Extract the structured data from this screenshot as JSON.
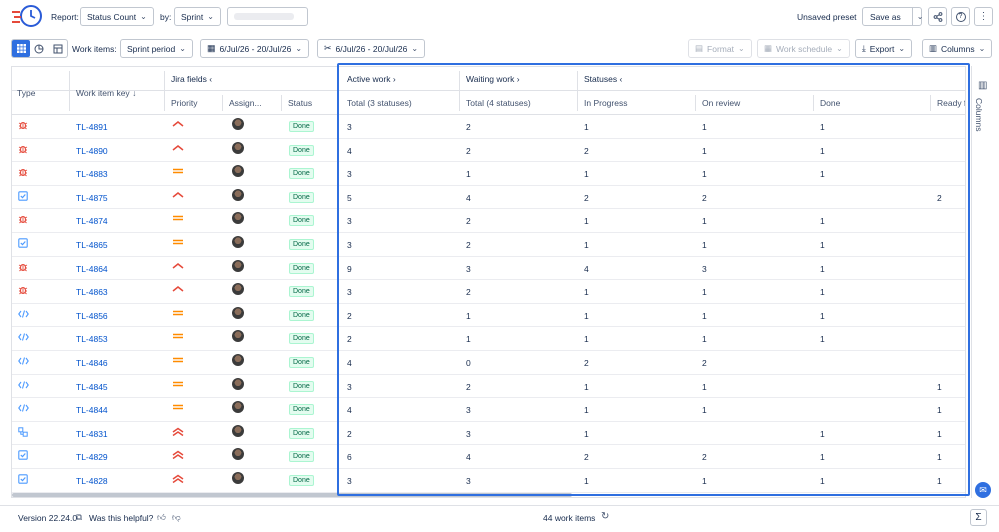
{
  "toolbar": {
    "report_label": "Report:",
    "report_value": "Status Count",
    "by_label": "by:",
    "by_value": "Sprint",
    "unsaved": "Unsaved preset",
    "save_as": "Save as"
  },
  "toolbar2": {
    "work_items_label": "Work items:",
    "work_items_value": "Sprint period",
    "date_range_1": "6/Jul/26 - 20/Jul/26",
    "date_range_2": "6/Jul/26 - 20/Jul/26",
    "format": "Format",
    "work_schedule": "Work schedule",
    "export": "Export",
    "columns": "Columns"
  },
  "table": {
    "group_headers": {
      "jira_fields": "Jira fields",
      "active_work": "Active work",
      "waiting_work": "Waiting work",
      "statuses": "Statuses"
    },
    "columns": {
      "type": "Type",
      "key": "Work item key",
      "priority": "Priority",
      "assignee": "Assign...",
      "status": "Status",
      "active_total": "Total (3 statuses)",
      "waiting_total": "Total (4 statuses)",
      "in_progress": "In Progress",
      "on_review": "On review",
      "done": "Done",
      "ready": "Ready fo"
    },
    "rows": [
      {
        "type": "bug",
        "key": "TL-4891",
        "priority": "high",
        "status": "Done",
        "active": "3",
        "waiting": "2",
        "inprog": "1",
        "review": "1",
        "done": "1",
        "ready": ""
      },
      {
        "type": "bug",
        "key": "TL-4890",
        "priority": "high",
        "status": "Done",
        "active": "4",
        "waiting": "2",
        "inprog": "2",
        "review": "1",
        "done": "1",
        "ready": ""
      },
      {
        "type": "bug",
        "key": "TL-4883",
        "priority": "medium",
        "status": "Done",
        "active": "3",
        "waiting": "1",
        "inprog": "1",
        "review": "1",
        "done": "1",
        "ready": ""
      },
      {
        "type": "task",
        "key": "TL-4875",
        "priority": "high",
        "status": "Done",
        "active": "5",
        "waiting": "4",
        "inprog": "2",
        "review": "2",
        "done": "",
        "ready": "2"
      },
      {
        "type": "bug",
        "key": "TL-4874",
        "priority": "medium",
        "status": "Done",
        "active": "3",
        "waiting": "2",
        "inprog": "1",
        "review": "1",
        "done": "1",
        "ready": ""
      },
      {
        "type": "task",
        "key": "TL-4865",
        "priority": "medium",
        "status": "Done",
        "active": "3",
        "waiting": "2",
        "inprog": "1",
        "review": "1",
        "done": "1",
        "ready": ""
      },
      {
        "type": "bug",
        "key": "TL-4864",
        "priority": "high",
        "status": "Done",
        "active": "9",
        "waiting": "3",
        "inprog": "4",
        "review": "3",
        "done": "1",
        "ready": ""
      },
      {
        "type": "bug",
        "key": "TL-4863",
        "priority": "high",
        "status": "Done",
        "active": "3",
        "waiting": "2",
        "inprog": "1",
        "review": "1",
        "done": "1",
        "ready": ""
      },
      {
        "type": "code",
        "key": "TL-4856",
        "priority": "medium",
        "status": "Done",
        "active": "2",
        "waiting": "1",
        "inprog": "1",
        "review": "1",
        "done": "1",
        "ready": ""
      },
      {
        "type": "code",
        "key": "TL-4853",
        "priority": "medium",
        "status": "Done",
        "active": "2",
        "waiting": "1",
        "inprog": "1",
        "review": "1",
        "done": "1",
        "ready": ""
      },
      {
        "type": "code",
        "key": "TL-4846",
        "priority": "medium",
        "status": "Done",
        "active": "4",
        "waiting": "0",
        "inprog": "2",
        "review": "2",
        "done": "",
        "ready": ""
      },
      {
        "type": "code",
        "key": "TL-4845",
        "priority": "medium",
        "status": "Done",
        "active": "3",
        "waiting": "2",
        "inprog": "1",
        "review": "1",
        "done": "",
        "ready": "1"
      },
      {
        "type": "code",
        "key": "TL-4844",
        "priority": "medium",
        "status": "Done",
        "active": "4",
        "waiting": "3",
        "inprog": "1",
        "review": "1",
        "done": "",
        "ready": "1"
      },
      {
        "type": "subtask",
        "key": "TL-4831",
        "priority": "highest",
        "status": "Done",
        "active": "2",
        "waiting": "3",
        "inprog": "1",
        "review": "",
        "done": "1",
        "ready": "1"
      },
      {
        "type": "task",
        "key": "TL-4829",
        "priority": "highest",
        "status": "Done",
        "active": "6",
        "waiting": "4",
        "inprog": "2",
        "review": "2",
        "done": "1",
        "ready": "1"
      },
      {
        "type": "task",
        "key": "TL-4828",
        "priority": "highest",
        "status": "Done",
        "active": "3",
        "waiting": "3",
        "inprog": "1",
        "review": "1",
        "done": "1",
        "ready": "1"
      }
    ]
  },
  "side_panel": {
    "label": "Columns"
  },
  "footer": {
    "version": "Version 22.24.0",
    "helpful": "Was this helpful?",
    "count": "44 work items"
  },
  "colors": {
    "accent": "#2f6fe0",
    "link": "#0052cc",
    "bug": "#e5493a",
    "task": "#4c9aff",
    "high": "#e5493a",
    "medium": "#ff8b00"
  }
}
